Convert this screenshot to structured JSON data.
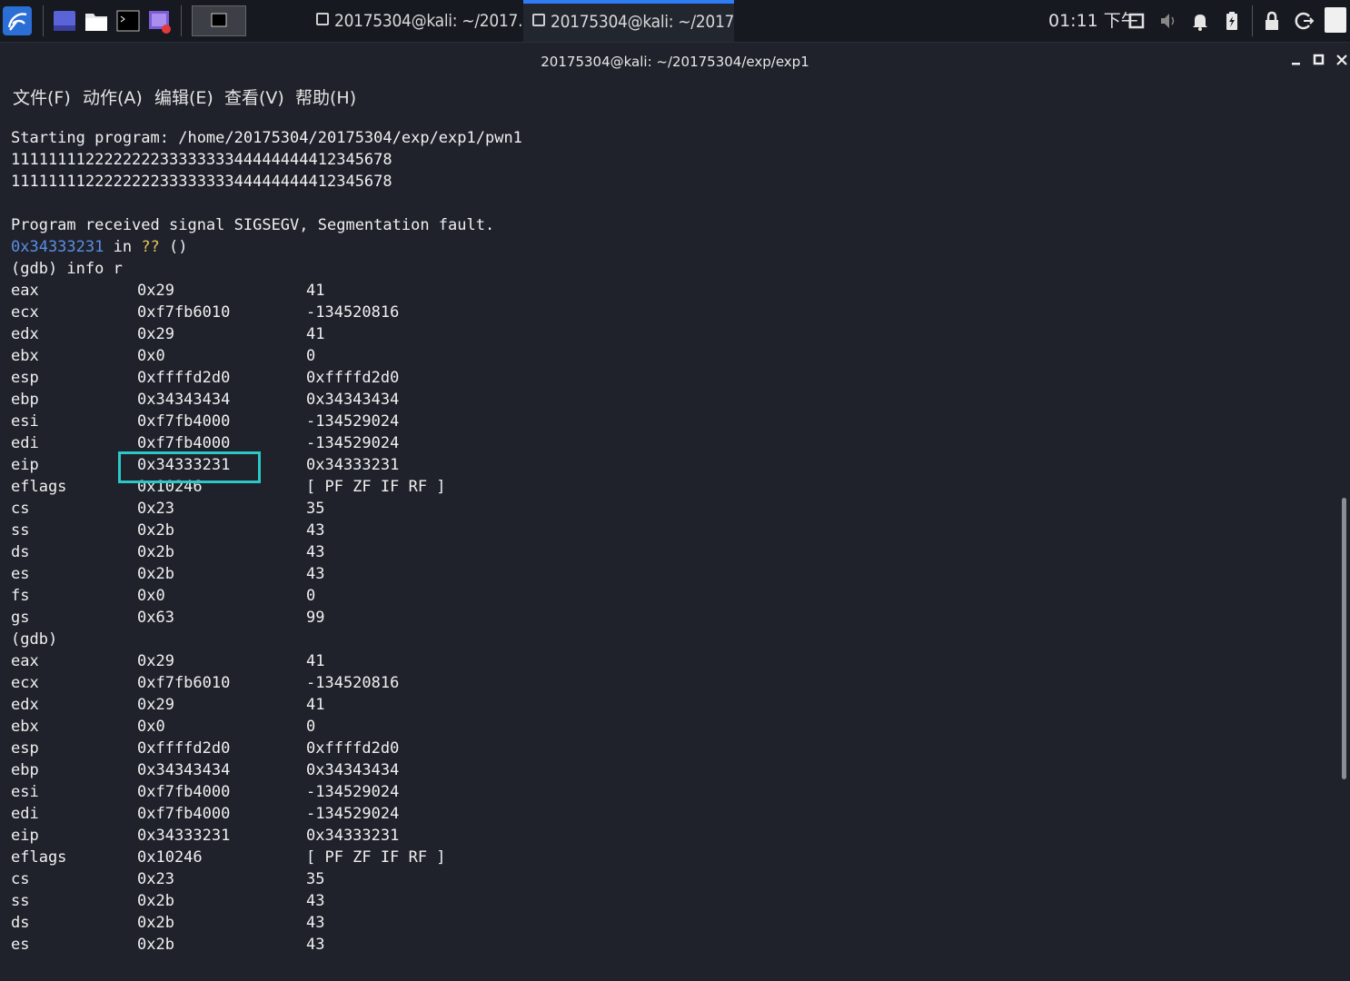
{
  "taskbar": {
    "tasks": [
      {
        "label": "20175304@kali: ~/2017...",
        "active": false
      },
      {
        "label": "20175304@kali: ~/2017...",
        "active": true
      }
    ],
    "clock": "01:11 下午"
  },
  "window": {
    "title": "20175304@kali: ~/20175304/exp/exp1"
  },
  "menu": [
    "文件(F)",
    "动作(A)",
    "编辑(E)",
    "查看(V)",
    "帮助(H)"
  ],
  "terminal": {
    "header_lines": [
      "Starting program: /home/20175304/20175304/exp/exp1/pwn1",
      "11111111222222223333333344444444412345678",
      "11111111222222223333333344444444412345678",
      "",
      "Program received signal SIGSEGV, Segmentation fault."
    ],
    "fault": {
      "addr": "0x34333231",
      "in": " in ",
      "fn": "??",
      "rest": " ()"
    },
    "cmd": "(gdb) info r",
    "regs1": [
      [
        "eax",
        "0x29",
        "41"
      ],
      [
        "ecx",
        "0xf7fb6010",
        "-134520816"
      ],
      [
        "edx",
        "0x29",
        "41"
      ],
      [
        "ebx",
        "0x0",
        "0"
      ],
      [
        "esp",
        "0xffffd2d0",
        "0xffffd2d0"
      ],
      [
        "ebp",
        "0x34343434",
        "0x34343434"
      ],
      [
        "esi",
        "0xf7fb4000",
        "-134529024"
      ],
      [
        "edi",
        "0xf7fb4000",
        "-134529024"
      ],
      [
        "eip",
        "0x34333231",
        "0x34333231"
      ],
      [
        "eflags",
        "0x10246",
        "[ PF ZF IF RF ]"
      ],
      [
        "cs",
        "0x23",
        "35"
      ],
      [
        "ss",
        "0x2b",
        "43"
      ],
      [
        "ds",
        "0x2b",
        "43"
      ],
      [
        "es",
        "0x2b",
        "43"
      ],
      [
        "fs",
        "0x0",
        "0"
      ],
      [
        "gs",
        "0x63",
        "99"
      ]
    ],
    "prompt2": "(gdb)",
    "regs2": [
      [
        "eax",
        "0x29",
        "41"
      ],
      [
        "ecx",
        "0xf7fb6010",
        "-134520816"
      ],
      [
        "edx",
        "0x29",
        "41"
      ],
      [
        "ebx",
        "0x0",
        "0"
      ],
      [
        "esp",
        "0xffffd2d0",
        "0xffffd2d0"
      ],
      [
        "ebp",
        "0x34343434",
        "0x34343434"
      ],
      [
        "esi",
        "0xf7fb4000",
        "-134529024"
      ],
      [
        "edi",
        "0xf7fb4000",
        "-134529024"
      ],
      [
        "eip",
        "0x34333231",
        "0x34333231"
      ],
      [
        "eflags",
        "0x10246",
        "[ PF ZF IF RF ]"
      ],
      [
        "cs",
        "0x23",
        "35"
      ],
      [
        "ss",
        "0x2b",
        "43"
      ],
      [
        "ds",
        "0x2b",
        "43"
      ],
      [
        "es",
        "0x2b",
        "43"
      ]
    ]
  },
  "colors": {
    "highlight": "#2cc7c7",
    "accent": "#2f7cf6"
  }
}
